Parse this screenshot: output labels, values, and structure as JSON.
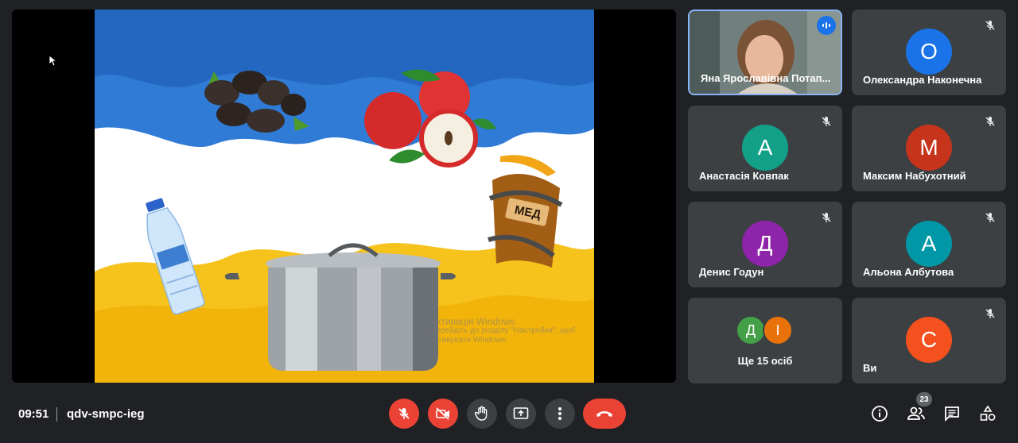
{
  "meeting": {
    "time": "09:51",
    "code": "qdv-smpc-ieg",
    "participants_count": "23"
  },
  "slide": {
    "honey_label": "МЕД"
  },
  "watermark": {
    "line1": "Активація Windows",
    "line2": "Перейдіть до розділу \"Настройки\", щоб",
    "line3": "активувати Windows."
  },
  "participants": [
    {
      "name": "Яна Ярославівна Потап...",
      "type": "video",
      "speaking": true
    },
    {
      "name": "Олександра Наконечна",
      "initial": "О",
      "color": "#1a73e8",
      "muted": true
    },
    {
      "name": "Анастасія Ковпак",
      "initial": "А",
      "color": "#12a089",
      "muted": true
    },
    {
      "name": "Максим Набухотний",
      "initial": "М",
      "color": "#c5341b",
      "muted": true
    },
    {
      "name": "Денис Годун",
      "initial": "Д",
      "color": "#8e24aa",
      "muted": true
    },
    {
      "name": "Альона Албутова",
      "initial": "А",
      "color": "#0097a7",
      "muted": true
    },
    {
      "name": "Ще 15 осіб",
      "type": "more",
      "initials": [
        "Д",
        "І"
      ],
      "colors": [
        "#43a047",
        "#e8710a"
      ]
    },
    {
      "name": "Ви",
      "initial": "С",
      "color": "#f4511e",
      "muted": true
    }
  ],
  "icons": {
    "mic": "mic-off-icon",
    "camera": "camera-off-icon",
    "hand": "raise-hand-icon",
    "present": "present-screen-icon",
    "more": "more-options-icon",
    "end": "end-call-icon",
    "info": "info-icon",
    "people": "people-icon",
    "chat": "chat-icon",
    "activities": "activities-icon"
  },
  "colors": {
    "background": "#202124",
    "tile": "#3c4043",
    "danger": "#ea4335",
    "accent": "#1a73e8"
  }
}
